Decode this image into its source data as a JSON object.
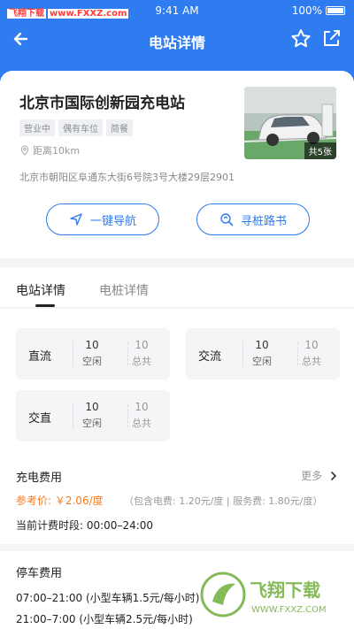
{
  "status": {
    "left_brand": "飞翔下载",
    "left_url": "www.FXXZ.com",
    "time": "9:41 AM",
    "battery": "100%"
  },
  "nav": {
    "title": "电站详情",
    "icons": {
      "back": "arrow-left-icon",
      "favorite": "star-icon",
      "edit": "edit-icon"
    }
  },
  "station": {
    "name": "北京市国际创新园充电站",
    "tags": [
      "营业中",
      "偶有车位",
      "简餐"
    ],
    "distance": "距离10km",
    "address": "北京市朝阳区阜通东大街6号院3号大楼29层2901",
    "photo_count": "共5张"
  },
  "actions": {
    "navigate": "一键导航",
    "guide": "寻桩路书"
  },
  "tabs": {
    "active": "电站详情",
    "inactive": "电桩详情"
  },
  "charger_counts": [
    {
      "type": "直流",
      "idle": "10",
      "idle_label": "空闲",
      "total": "10",
      "total_label": "总共"
    },
    {
      "type": "交流",
      "idle": "10",
      "idle_label": "空闲",
      "total": "10",
      "total_label": "总共"
    },
    {
      "type": "交直",
      "idle": "10",
      "idle_label": "空闲",
      "total": "10",
      "total_label": "总共"
    }
  ],
  "fees": {
    "title": "充电费用",
    "more": "更多",
    "reference_price": "参考价: ￥2.06/度",
    "reference_detail": "（包含电费: 1.20元/度 | 服务费: 1.80元/度）",
    "current_period": "当前计费时段: 00:00–24:00"
  },
  "parking": {
    "title": "停车费用",
    "lines": [
      "07:00–21:00 (小型车辆1.5元/每小时)",
      "21:00–7:00 (小型车辆2.5元/每小时)"
    ]
  },
  "watermark": {
    "text": "飞翔下载",
    "url": "WWW.FXXZ.COM"
  },
  "colors": {
    "primary": "#2f7bf0",
    "price": "#ff7a1a",
    "background": "#f4f5f7"
  }
}
